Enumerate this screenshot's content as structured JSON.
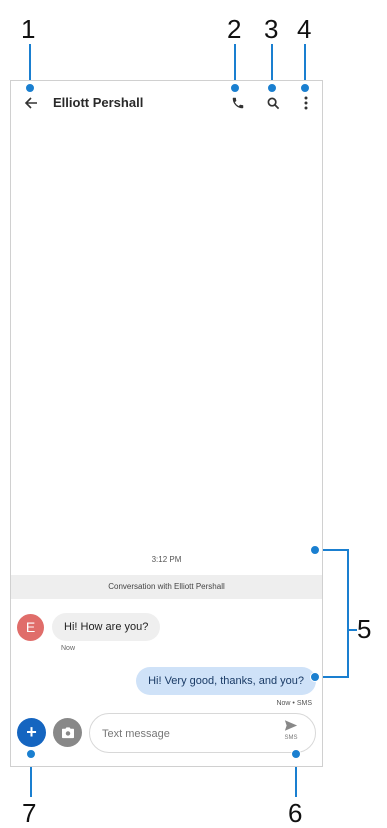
{
  "callouts": [
    "1",
    "2",
    "3",
    "4",
    "5",
    "6",
    "7"
  ],
  "header": {
    "contact_name": "Elliott Pershall",
    "icons": [
      "back-arrow-icon",
      "phone-icon",
      "search-icon",
      "more-vert-icon"
    ]
  },
  "conversation": {
    "timestamp": "3:12 PM",
    "banner": "Conversation with Elliott Pershall",
    "avatar_initial": "E",
    "avatar_color": "#e06d6a",
    "incoming": {
      "text": "Hi! How are you?",
      "meta": "Now"
    },
    "outgoing": {
      "text": "Hi! Very good, thanks, and you?",
      "meta": "Now • SMS"
    }
  },
  "compose": {
    "placeholder": "Text message",
    "send_label": "SMS",
    "icons": [
      "add-icon",
      "camera-icon",
      "send-icon"
    ]
  },
  "colors": {
    "accent": "#1a7fd0",
    "fab": "#1565c0",
    "outgoing_bubble": "#cfe2f8",
    "incoming_bubble": "#efefef"
  }
}
